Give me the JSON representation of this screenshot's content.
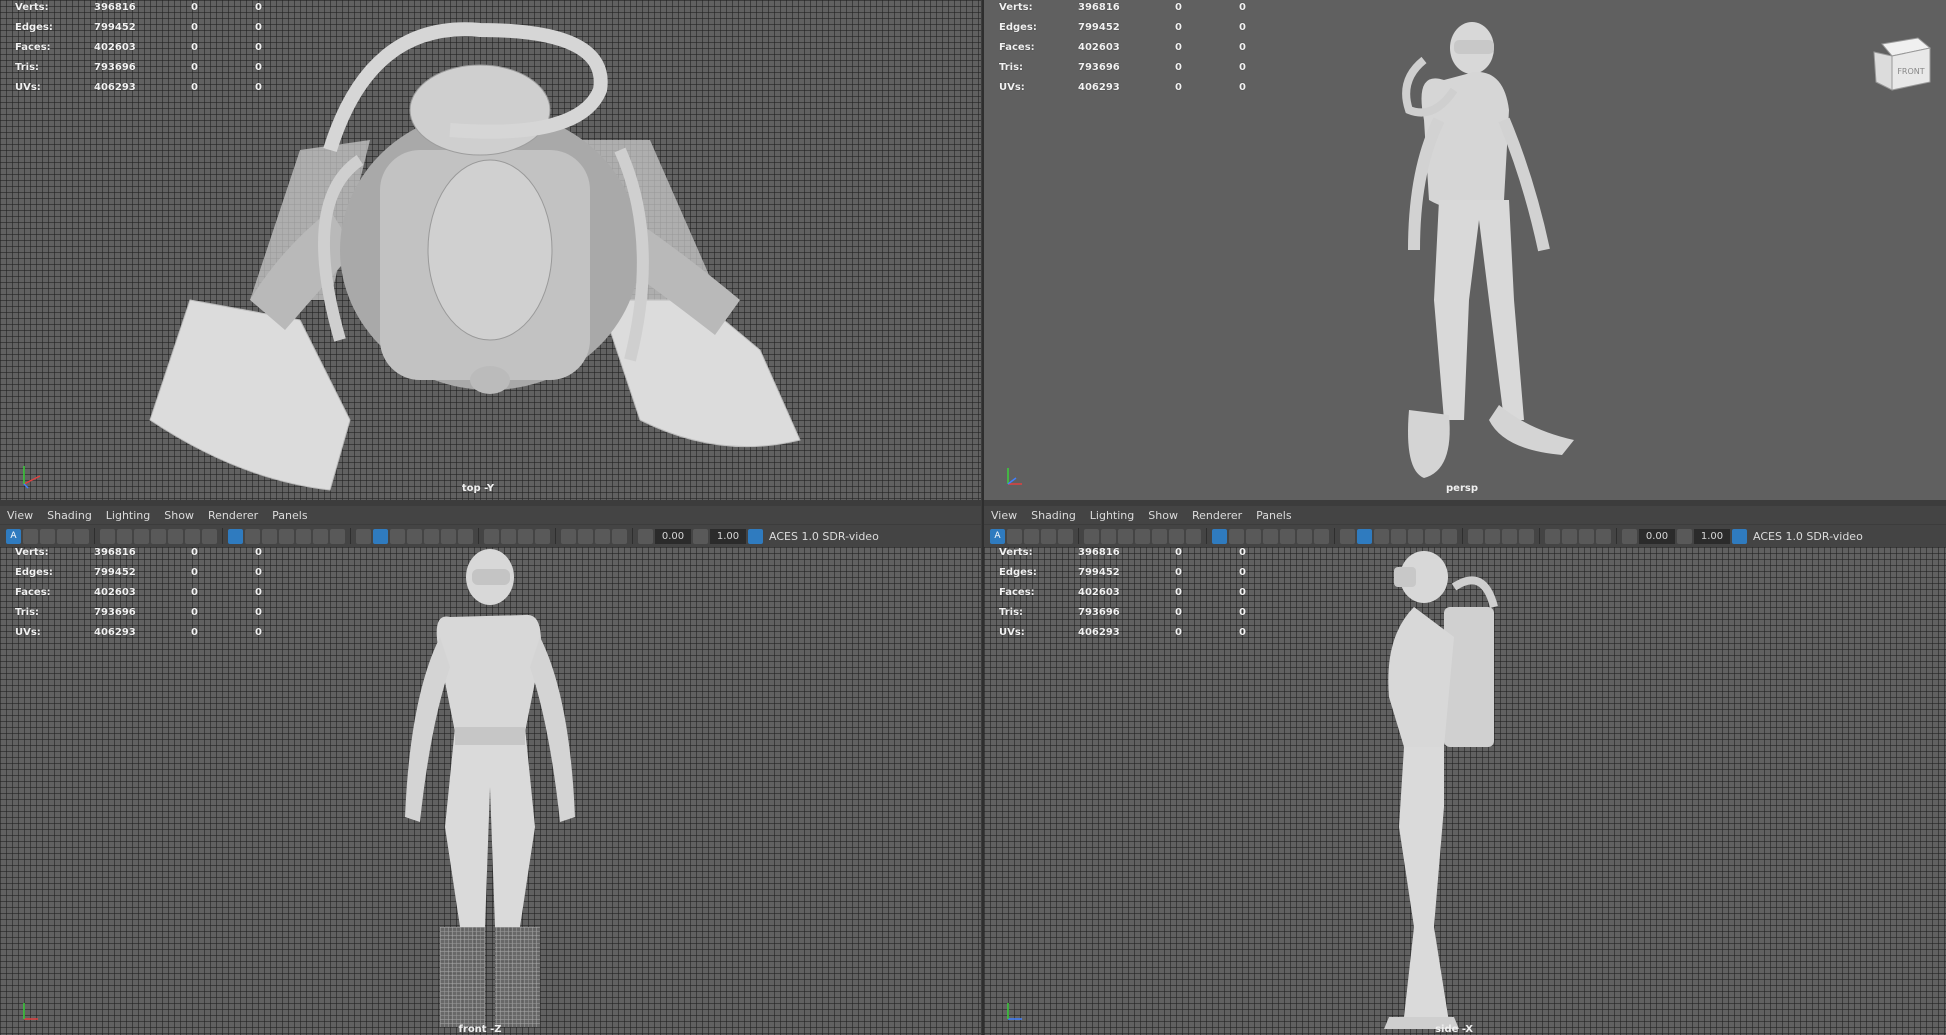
{
  "stats": {
    "rows": [
      {
        "label": "Verts:",
        "value": "396816",
        "sel": "0",
        "sel2": "0"
      },
      {
        "label": "Edges:",
        "value": "799452",
        "sel": "0",
        "sel2": "0"
      },
      {
        "label": "Faces:",
        "value": "402603",
        "sel": "0",
        "sel2": "0"
      },
      {
        "label": "Tris:",
        "value": "793696",
        "sel": "0",
        "sel2": "0"
      },
      {
        "label": "UVs:",
        "value": "406293",
        "sel": "0",
        "sel2": "0"
      }
    ]
  },
  "panels": {
    "top": {
      "camera": "top -Y"
    },
    "persp": {
      "camera": "persp",
      "viewcube_face": "FRONT"
    },
    "front": {
      "camera": "front -Z"
    },
    "side": {
      "camera": "side -X"
    }
  },
  "menu": [
    "View",
    "Shading",
    "Lighting",
    "Show",
    "Renderer",
    "Panels"
  ],
  "toolbar": {
    "exposure": "0.00",
    "gamma": "1.00",
    "color_space": "ACES 1.0 SDR-video"
  },
  "colors": {
    "viewport_bg": "#5d5d5d",
    "toolbar_bg": "#444444",
    "accent": "#2f7bbf",
    "mesh": "#d9d9d9"
  }
}
